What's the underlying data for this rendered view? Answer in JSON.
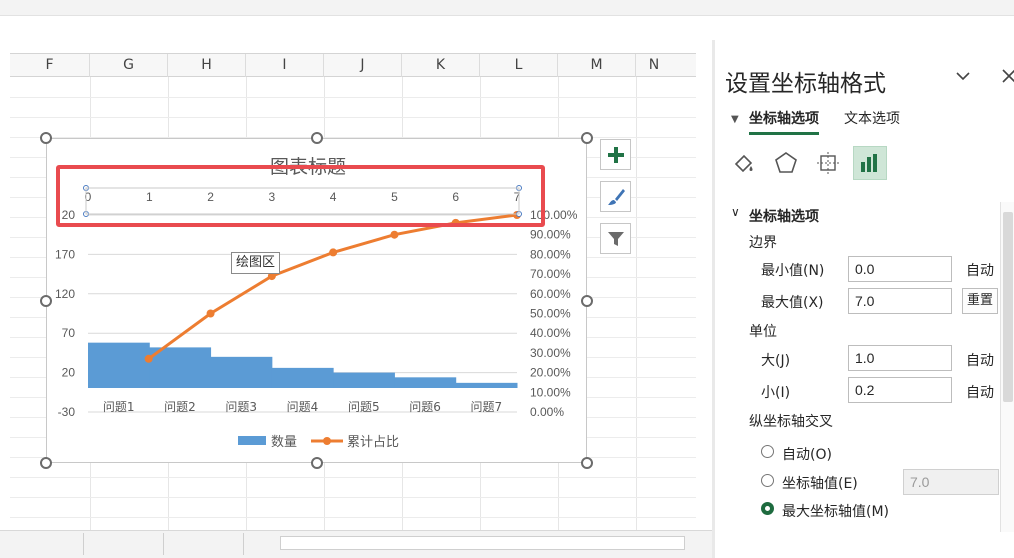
{
  "spreadsheet": {
    "columns": [
      "F",
      "G",
      "H",
      "I",
      "J",
      "K",
      "L",
      "M",
      "N"
    ]
  },
  "chart": {
    "title": "图表标题",
    "plot_area_tooltip": "绘图区",
    "legend": [
      "数量",
      "累计占比"
    ],
    "colors": {
      "bar": "#5b9bd5",
      "line": "#ed7d31",
      "highlight": "#e94b4f",
      "accent": "#217346"
    },
    "float_buttons": [
      "plus-icon",
      "brush-icon",
      "filter-icon"
    ]
  },
  "chart_data": {
    "type": "bar",
    "title": "图表标题",
    "categories": [
      "问题1",
      "问题2",
      "问题3",
      "问题4",
      "问题5",
      "问题6",
      "问题7"
    ],
    "series": [
      {
        "name": "数量",
        "type": "bar",
        "axis": "primary",
        "values": [
          58,
          52,
          40,
          26,
          20,
          14,
          7
        ]
      },
      {
        "name": "累计占比",
        "type": "line",
        "axis": "secondary",
        "x": [
          0.99,
          2,
          3,
          4,
          5,
          6,
          7
        ],
        "values": [
          0.27,
          0.5,
          0.69,
          0.81,
          0.9,
          0.96,
          1.0
        ]
      }
    ],
    "y_left": {
      "ticks": [
        "-30",
        "20",
        "70",
        "120",
        "170",
        "20"
      ],
      "ylim": [
        -30,
        220
      ]
    },
    "y_right": {
      "ticks": [
        "0.00%",
        "10.00%",
        "20.00%",
        "30.00%",
        "40.00%",
        "50.00%",
        "60.00%",
        "70.00%",
        "80.00%",
        "90.00%",
        "100.00%"
      ],
      "ylim": [
        0,
        1
      ]
    },
    "x_top": {
      "ticks": [
        "0",
        "1",
        "2",
        "3",
        "4",
        "5",
        "6",
        "7"
      ],
      "xlim": [
        0,
        7
      ]
    },
    "legend": "bottom",
    "grid": true
  },
  "panel": {
    "title": "设置坐标轴格式",
    "tabs": [
      "坐标轴选项",
      "文本选项"
    ],
    "section": "坐标轴选项",
    "bounds": {
      "label": "边界",
      "min_label": "最小值(N)",
      "min_value": "0.0",
      "min_status": "自动",
      "max_label": "最大值(X)",
      "max_value": "7.0",
      "max_status": "重置"
    },
    "units": {
      "label": "单位",
      "major_label": "大(J)",
      "major_value": "1.0",
      "major_status": "自动",
      "minor_label": "小(I)",
      "minor_value": "0.2",
      "minor_status": "自动"
    },
    "cross": {
      "label": "纵坐标轴交叉",
      "options": [
        "自动(O)",
        "坐标轴值(E)",
        "最大坐标轴值(M)"
      ],
      "axis_value": "7.0",
      "selected": 2
    }
  }
}
